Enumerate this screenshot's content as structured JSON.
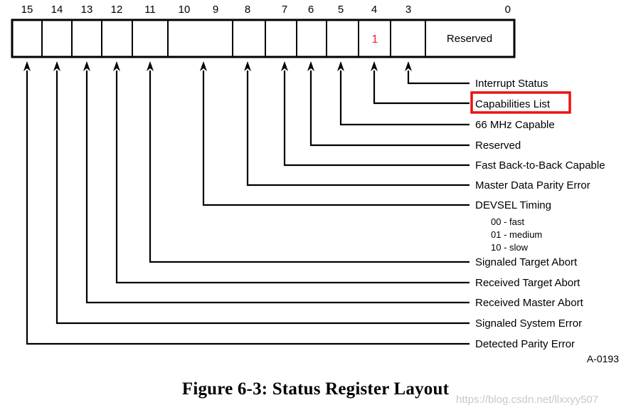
{
  "figure": {
    "caption": "Figure 6-3:  Status Register Layout",
    "drawing_id": "A-0193",
    "watermark": "https://blog.csdn.net/llxxyy507"
  },
  "register": {
    "name": "Status Register",
    "width_bits": 16,
    "bit_labels": [
      "15",
      "14",
      "13",
      "12",
      "11",
      "10",
      "9",
      "8",
      "7",
      "6",
      "5",
      "4",
      "3",
      "0"
    ],
    "reserved_field_text": "Reserved",
    "highlighted_bit_value": "1",
    "highlighted_bit_value_color": "#ff1a1a",
    "cells": [
      {
        "bits": "15",
        "text": ""
      },
      {
        "bits": "14",
        "text": ""
      },
      {
        "bits": "13",
        "text": ""
      },
      {
        "bits": "12",
        "text": ""
      },
      {
        "bits": "11",
        "text": ""
      },
      {
        "bits": "10-9",
        "text": ""
      },
      {
        "bits": "8",
        "text": ""
      },
      {
        "bits": "7",
        "text": ""
      },
      {
        "bits": "6",
        "text": ""
      },
      {
        "bits": "5",
        "text": ""
      },
      {
        "bits": "4",
        "text": "1"
      },
      {
        "bits": "3",
        "text": ""
      },
      {
        "bits": "2-0",
        "text": "Reserved"
      }
    ]
  },
  "callouts": [
    {
      "bit": "3",
      "label": "Interrupt Status",
      "highlighted": false
    },
    {
      "bit": "4",
      "label": "Capabilities List",
      "highlighted": true
    },
    {
      "bit": "5",
      "label": "66 MHz Capable",
      "highlighted": false
    },
    {
      "bit": "6",
      "label": "Reserved",
      "highlighted": false
    },
    {
      "bit": "7",
      "label": "Fast Back-to-Back Capable",
      "highlighted": false
    },
    {
      "bit": "8",
      "label": "Master Data Parity Error",
      "highlighted": false
    },
    {
      "bit": "10-9",
      "label": "DEVSEL Timing",
      "highlighted": false
    },
    {
      "bit": "11",
      "label": "Signaled Target Abort",
      "highlighted": false
    },
    {
      "bit": "12",
      "label": "Received Target Abort",
      "highlighted": false
    },
    {
      "bit": "13",
      "label": "Received Master Abort",
      "highlighted": false
    },
    {
      "bit": "14",
      "label": "Signaled System Error",
      "highlighted": false
    },
    {
      "bit": "15",
      "label": "Detected Parity Error",
      "highlighted": false
    }
  ],
  "devsel_encodings": [
    "00 - fast",
    "01 - medium",
    "10 - slow"
  ],
  "colors": {
    "highlight": "#ee1111",
    "bit_value": "#ff1a1a",
    "line": "#000000",
    "background": "#ffffff",
    "watermark": "#c9c9c9"
  }
}
